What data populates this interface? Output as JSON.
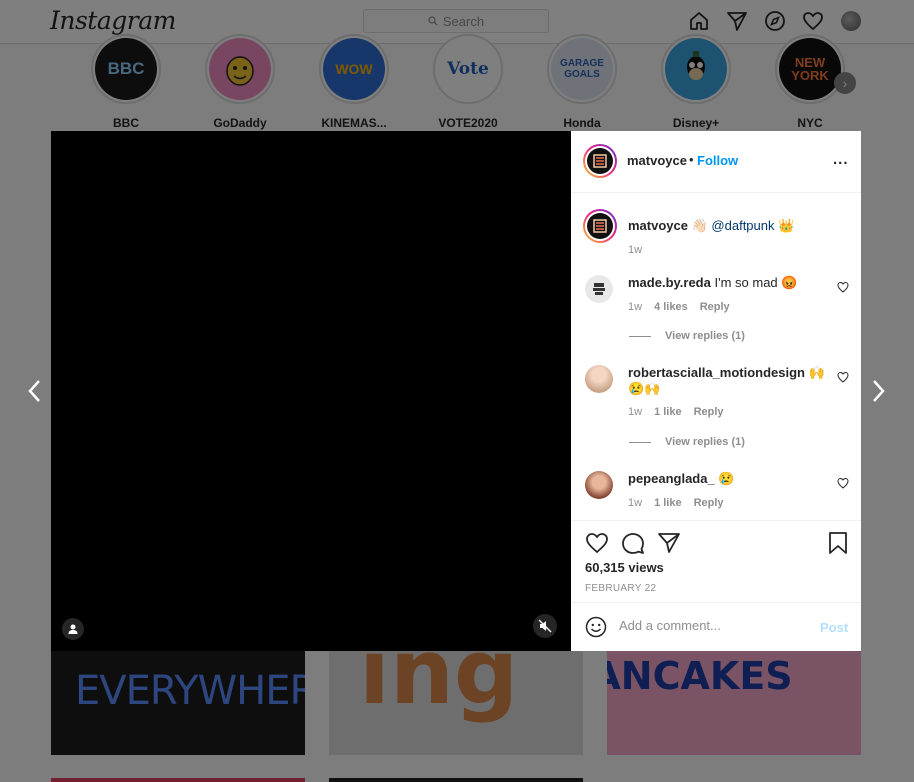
{
  "app": {
    "logo": "Instagram"
  },
  "search": {
    "placeholder": "Search"
  },
  "stories": [
    {
      "name": "BBC",
      "badge": "BBC"
    },
    {
      "name": "GoDaddy",
      "badge": ""
    },
    {
      "name": "KINEMAS...",
      "badge": "WOW"
    },
    {
      "name": "VOTE2020",
      "badge": "Vote"
    },
    {
      "name": "Honda",
      "badge": "GARAGE GOALS"
    },
    {
      "name": "Disney+",
      "badge": ""
    },
    {
      "name": "NYC",
      "badge": "NEW YORK"
    }
  ],
  "grid": [
    {
      "text": "EVERYWHERE!"
    },
    {
      "text": "ing"
    },
    {
      "text": "PANCAKES"
    }
  ],
  "post": {
    "username": "matvoyce",
    "separator": "•",
    "follow": "Follow",
    "more": "...",
    "caption": {
      "username": "matvoyce",
      "emoji": "👋🏻",
      "mention": "@daftpunk",
      "emoji2": "👑",
      "time": "1w"
    },
    "comments": [
      {
        "username": "made.by.reda",
        "text": "I'm so mad 😡",
        "time": "1w",
        "likes": "4 likes",
        "reply": "Reply",
        "view_replies": "View replies (1)"
      },
      {
        "username": "robertascialla_motiondesign",
        "text": "🙌😢🙌",
        "time": "1w",
        "likes": "1 like",
        "reply": "Reply",
        "view_replies": "View replies (1)"
      },
      {
        "username": "pepeanglada_",
        "text": "😢",
        "time": "1w",
        "likes": "1 like",
        "reply": "Reply"
      }
    ],
    "views": "60,315 views",
    "date": "FEBRUARY 22",
    "add_comment_placeholder": "Add a comment...",
    "post_label": "Post"
  },
  "colors": {
    "accent": "#0095f6",
    "post_disabled": "#b2dffc",
    "like_red": "#ed4956"
  },
  "icons": [
    "home-icon",
    "direct-icon",
    "explore-icon",
    "activity-heart-icon",
    "search-icon",
    "heart-icon",
    "comment-icon",
    "share-icon",
    "bookmark-icon",
    "emoji-icon",
    "mute-icon",
    "user-tag-icon",
    "chevron-left-icon",
    "chevron-right-icon"
  ]
}
